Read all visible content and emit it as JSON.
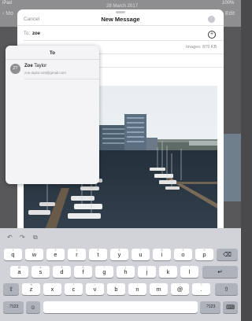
{
  "background": {
    "date": "28 March 2017",
    "back_label": "Mo",
    "edit_label": "Edit"
  },
  "compose": {
    "cancel": "Cancel",
    "title": "New Message",
    "to_label": "To:",
    "to_value": "zoe",
    "images_size": "Images: 875 KB"
  },
  "autocomplete": {
    "title": "To",
    "contact": {
      "initials": "ZT",
      "name_first": "Zoe",
      "name_last": "Taylor",
      "email": "zoe.taylor.smt@gmail.com"
    }
  },
  "keyboard": {
    "row1": [
      "q",
      "w",
      "e",
      "r",
      "t",
      "y",
      "u",
      "i",
      "o",
      "p"
    ],
    "row1_hints": [
      "1",
      "2",
      "3",
      "4",
      "5",
      "6",
      "7",
      "8",
      "9",
      "0"
    ],
    "row2": [
      "a",
      "s",
      "d",
      "f",
      "g",
      "h",
      "j",
      "k",
      "l"
    ],
    "row2_hints": [
      "@",
      "#",
      "$",
      "&",
      "*",
      "(",
      ")",
      "'",
      "\""
    ],
    "row3": [
      "z",
      "x",
      "c",
      "v",
      "b",
      "n",
      "m",
      "@",
      "."
    ],
    "row3_hints": [
      "%",
      "-",
      "+",
      "=",
      "/",
      ";",
      ":",
      "!",
      "?"
    ],
    "numbers_label": ".?123",
    "done_label": "Done"
  }
}
